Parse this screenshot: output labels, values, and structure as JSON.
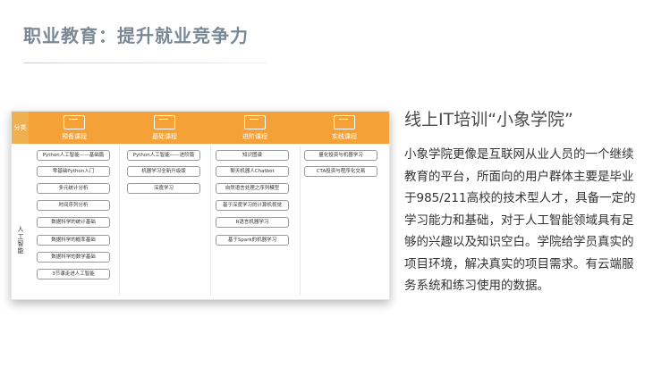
{
  "page": {
    "title": "职业教育：提升就业竞争力",
    "right_title": "线上IT培训“小象学院”",
    "right_body": "小象学院更像是互联网从业人员的一个继续教育的平台，所面向的用户群体主要是毕业于985/211高校的技术型人才，具备一定的学习能力和基础，对于人工智能领域具有足够的兴趣以及知识空白。学院给学员真实的项目环境，解决真实的项目需求。有云端服务系统和练习使用的数据。"
  },
  "curriculum": {
    "category_header": "分类",
    "row_category": "人工智能",
    "columns": [
      {
        "label": "预备课程",
        "icon": "monitor-icon",
        "items": [
          "Python人工智能——基础篇",
          "零基础Python入门",
          "多元统计分析",
          "时间序列分析",
          "数据科学的统计基础",
          "数据科学的概率基础",
          "数据科学的数学基础",
          "3节课走进人工智能"
        ]
      },
      {
        "label": "基础课程",
        "icon": "monitor-user-icon",
        "items": [
          "Python人工智能——进阶篇",
          "机器学习全新升级版",
          "深度学习"
        ]
      },
      {
        "label": "进阶课程",
        "icon": "monitor-chart-icon",
        "items": [
          "知识图谱",
          "聊天机器人Chatbot",
          "自然语言处理之序列模型",
          "基于深度学习的计算机视觉",
          "R语言机器学习",
          "基于Spark的机器学习"
        ]
      },
      {
        "label": "实践课程",
        "icon": "monitor-code-icon",
        "items": [
          "量化投资与机器学习",
          "CTA投资与程序化交易"
        ]
      }
    ]
  }
}
